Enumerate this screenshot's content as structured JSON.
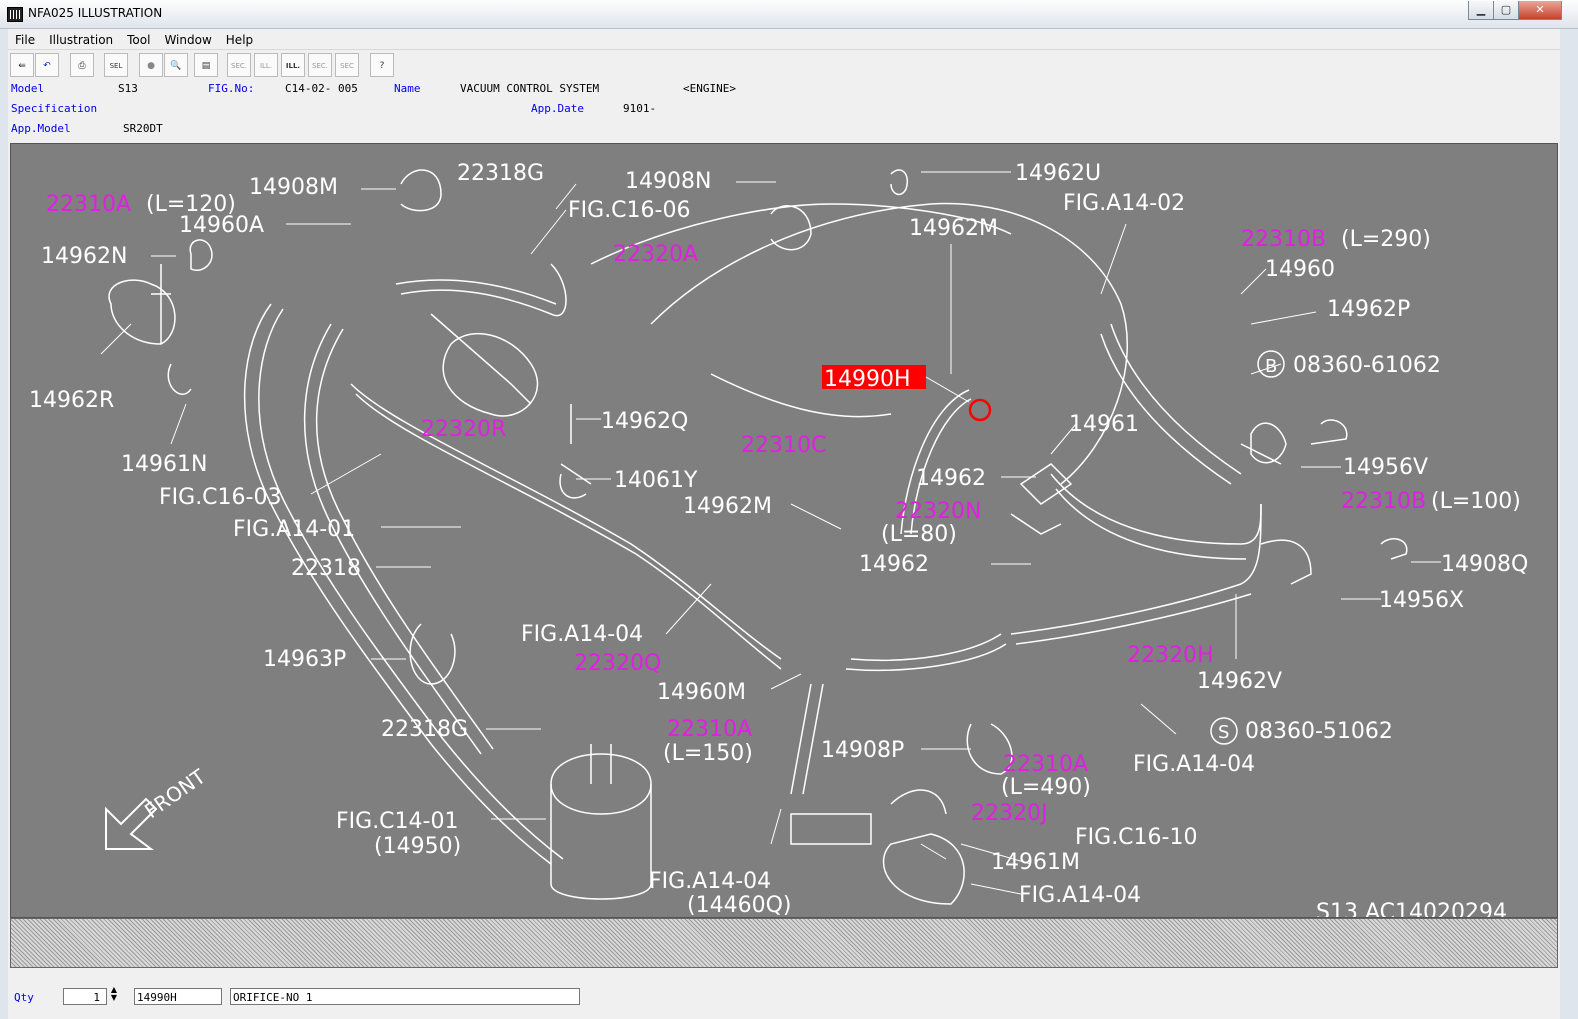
{
  "window": {
    "title": "NFA025  ILLUSTRATION"
  },
  "menu": [
    "File",
    "Illustration",
    "Tool",
    "Window",
    "Help"
  ],
  "toolbar": {
    "buttons": [
      {
        "name": "exit-button",
        "glyph": "⇚"
      },
      {
        "name": "undo-button",
        "glyph": "↶"
      },
      {
        "name": "print-button",
        "glyph": "⎙"
      },
      {
        "name": "select-button",
        "glyph": "SEL"
      },
      {
        "name": "circle-button",
        "glyph": "●"
      },
      {
        "name": "zoom-button",
        "glyph": "🔍"
      },
      {
        "name": "catalog-button",
        "glyph": "▤"
      },
      {
        "name": "sec-button",
        "glyph": "SEC."
      },
      {
        "name": "ill-prev-button",
        "glyph": "ILL."
      },
      {
        "name": "ill-button",
        "glyph": "ILL."
      },
      {
        "name": "sec-next-button",
        "glyph": "SEC."
      },
      {
        "name": "sec-help-button",
        "glyph": "SEC"
      },
      {
        "name": "help-button",
        "glyph": "?"
      }
    ]
  },
  "header": {
    "model_label": "Model",
    "model": "S13",
    "fig_label": "FIG.No:",
    "fig": "C14-02- 005",
    "name_label": "Name",
    "name": "VACUUM CONTROL SYSTEM",
    "section": "<ENGINE>",
    "spec_label": "Specification",
    "appdate_label": "App.Date",
    "appdate": "9101-",
    "appmodel_label": "App.Model",
    "appmodel": "SR20DT"
  },
  "colors": {
    "canvas": "#7f7f7f",
    "line": "#ffffff",
    "magenta": "#e020e0",
    "highlight": "#ff0000"
  },
  "labels": {
    "white": [
      "14908M",
      "22318G",
      "14908N",
      "14962U",
      "14960A",
      "FIG.C16-06",
      "FIG.A14-02",
      "14962N",
      "14962M",
      "14960",
      "14962P",
      "14962R",
      "08360-61062",
      "14962Q",
      "14961",
      "14961N",
      "14061Y",
      "14962",
      "14956V",
      "FIG.C16-03",
      "14962M",
      "(L=80)",
      "FIG.A14-01",
      "14962",
      "14908Q",
      "22318",
      "14956X",
      "FIG.A14-04",
      "14963P",
      "14962V",
      "14960M",
      "08360-51062",
      "22318G",
      "(L=150)",
      "14908P",
      "FIG.A14-04",
      "(L=490)",
      "FIG.C14-01",
      "(14950)",
      "FIG.C16-10",
      "14961M",
      "FIG.A14-04",
      "(14460Q)",
      "FIG.A14-04",
      "S13   AC14020294",
      "FRONT",
      "(L=120)",
      "(L=290)",
      "(L=100)",
      "B",
      "S"
    ],
    "magenta": [
      "22310A",
      "22320A",
      "22310B",
      "22320R",
      "22310C",
      "22320N",
      "22310B",
      "22320H",
      "22320Q",
      "22310A",
      "22310A",
      "22320J"
    ],
    "selected": "14990H"
  },
  "status": {
    "qty_label": "Qty",
    "qty": "1",
    "part": "14990H",
    "desc": "ORIFICE-NO 1"
  }
}
